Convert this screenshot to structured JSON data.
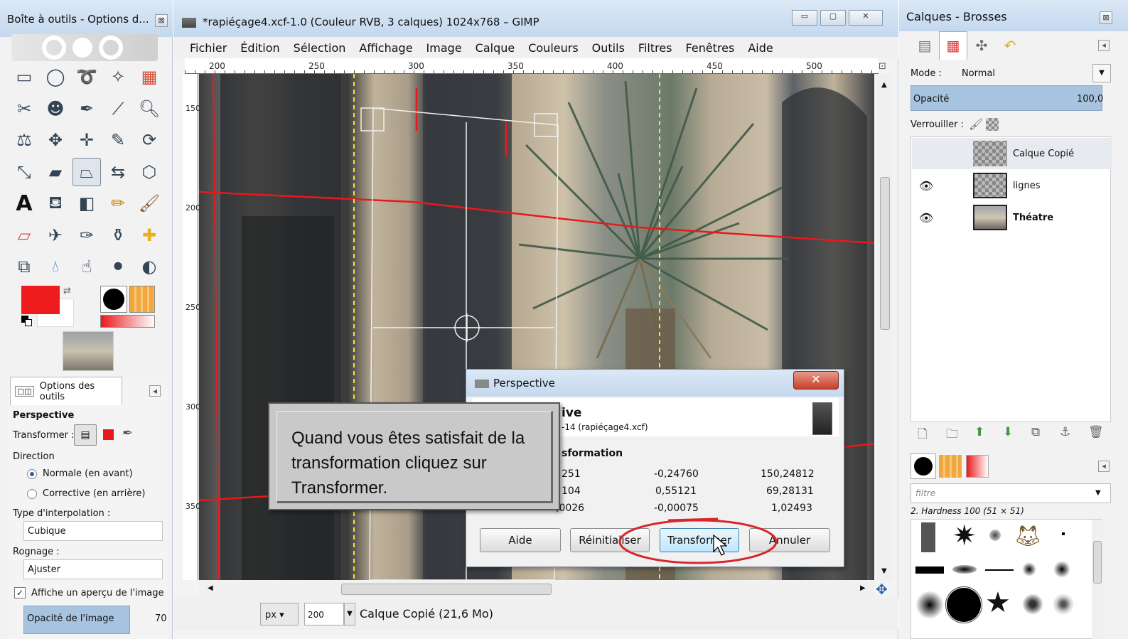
{
  "toolbox": {
    "title": "Boîte à outils - Options d...",
    "tool_options_tab": "Options des outils",
    "section_title": "Perspective",
    "transform_label": "Transformer :",
    "direction_label": "Direction",
    "direction_options": [
      "Normale (en avant)",
      "Corrective (en arrière)"
    ],
    "interpolation_label": "Type d'interpolation :",
    "interpolation_value": "Cubique",
    "clipping_label": "Rognage :",
    "clipping_value": "Ajuster",
    "preview_label": "Affiche un aperçu de l'image",
    "opacity_label": "Opacité de l'image",
    "opacity_value": "70",
    "fg_color": "#ee1c1c",
    "bg_color": "#ffffff"
  },
  "image_window": {
    "title": "*rapiéçage4.xcf-1.0 (Couleur RVB, 3 calques) 1024x768 – GIMP",
    "menu": [
      "Fichier",
      "Édition",
      "Sélection",
      "Affichage",
      "Image",
      "Calque",
      "Couleurs",
      "Outils",
      "Filtres",
      "Fenêtres",
      "Aide"
    ],
    "ruler_h": [
      "200",
      "250",
      "300",
      "350",
      "400",
      "450",
      "500"
    ],
    "ruler_v": [
      "150",
      "200",
      "250",
      "300",
      "350"
    ],
    "unit": "px",
    "zoom": "200",
    "status": "Calque Copié (21,6 Mo)"
  },
  "dialog": {
    "title": "Perspective",
    "heading": "ive",
    "subheading": "-14 (rapiéçage4.xcf)",
    "matrix_title": "sformation",
    "matrix": [
      [
        "251",
        "-0,24760",
        "150,24812"
      ],
      [
        "104",
        "0,55121",
        "69,28131"
      ],
      [
        ",0026",
        "-0,00075",
        "1,02493"
      ]
    ],
    "buttons": {
      "help": "Aide",
      "reset": "Réinitialiser",
      "transform": "Transformer",
      "cancel": "Annuler"
    },
    "close": "✕"
  },
  "callout": {
    "text": "Quand vous êtes satisfait de la transformation cliquez sur Transformer."
  },
  "dock": {
    "title": "Calques - Brosses",
    "mode_label": "Mode :",
    "mode_value": "Normal",
    "opacity_label": "Opacité",
    "opacity_value": "100,0",
    "lock_label": "Verrouiller :",
    "layers": [
      {
        "name": "Calque Copié",
        "visible": false
      },
      {
        "name": "lignes",
        "visible": true
      },
      {
        "name": "Théatre",
        "visible": true
      }
    ],
    "brush_filter_placeholder": "filtre",
    "brush_name": "2. Hardness 100 (51 × 51)"
  },
  "colors": {
    "accent_red": "#e8191c",
    "guide_yellow": "#f5e23a",
    "highlight_red": "#d9262a"
  }
}
